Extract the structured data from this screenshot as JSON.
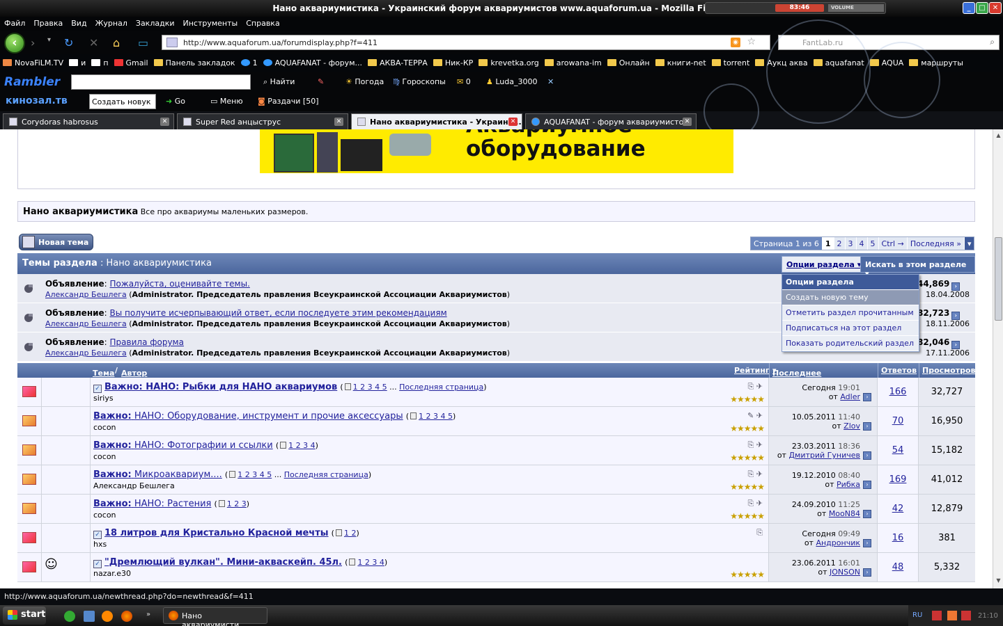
{
  "window": {
    "title": "Нано аквариумистика - Украинский форум аквариумистов www.aquaforum.ua - Mozilla Firefox",
    "player_lcd": "83:46",
    "volume": "VOLUME"
  },
  "menu": [
    "Файл",
    "Правка",
    "Вид",
    "Журнал",
    "Закладки",
    "Инструменты",
    "Справка"
  ],
  "nav": {
    "url": "http://www.aquaforum.ua/forumdisplay.php?f=411",
    "search_placeholder": "FantLab.ru"
  },
  "bookmarks": [
    "NovaFiLM.TV",
    "и",
    "п",
    "Gmail",
    "Панель закладок",
    "1",
    "AQUAFANAT - форум...",
    "АКВА-ТЕРРА",
    "Ник-КР",
    "krevetka.org",
    "arowana-im",
    "Онлайн",
    "книги-net",
    "torrent",
    "Аукц аква",
    "aquafanat",
    "AQUA",
    "маршруты"
  ],
  "rambler": {
    "logo": "Rambler",
    "find": "Найти",
    "weather": "Погода",
    "horoscopes": "Гороскопы",
    "count": "0",
    "user": "Luda_3000"
  },
  "kinozal": {
    "logo": "кинозал.тв",
    "input": "Создать новук",
    "go": "Go",
    "menu": "Меню",
    "distr": "Раздачи [50]"
  },
  "tabs": [
    {
      "label": "Corydoras habrosus"
    },
    {
      "label": "Super Red анцыструс"
    },
    {
      "label": "Нано аквариумистика - Украинс..."
    },
    {
      "label": "AQUAFANAT - форум аквариумистов"
    }
  ],
  "banner": {
    "text_top": "Аквариумное",
    "text": "оборудование"
  },
  "forum": {
    "title": "Нано аквариумистика",
    "desc": "Все про аквариумы маленьких размеров."
  },
  "new_thread": "Новая тема",
  "pagenav": {
    "label": "Страница 1 из 6",
    "pages": [
      "1",
      "2",
      "3",
      "4",
      "5"
    ],
    "next": "Ctrl →",
    "last": "Последняя »"
  },
  "section": {
    "title": "Темы раздела",
    "name": "Нано аквариумистика",
    "options": "Опции раздела",
    "search": "Искать в этом разделе"
  },
  "dropdown": [
    "Опции раздела",
    "Создать новую тему",
    "Отметить раздел прочитанным",
    "Подписаться на этот раздел",
    "Показать родительский раздел"
  ],
  "announcements": [
    {
      "prefix": "Объявление",
      "title": "Пожалуйста, оценивайте темы.",
      "author": "Александр Бешлега",
      "role": "Administrator. Председатель правления Всеукраинской Ассоциации Аквариумистов",
      "views": "44,869",
      "date": "18.04.2008"
    },
    {
      "prefix": "Объявление",
      "title": "Вы получите исчерпывающий ответ, если последуете этим рекомендациям",
      "author": "Александр Бешлега",
      "role": "Administrator. Председатель правления Всеукраинской Ассоциации Аквариумистов",
      "views": "82,723",
      "date": "18.11.2006"
    },
    {
      "prefix": "Объявление",
      "title": "Правила форума",
      "author": "Александр Бешлега",
      "role": "Administrator. Председатель правления Всеукраинской Ассоциации Аквариумистов",
      "views": "82,046",
      "date": "17.11.2006"
    }
  ],
  "columns": {
    "topic": "Тема",
    "author": "Автор",
    "rating": "Рейтинг",
    "last": "Последнее сообщение",
    "replies": "Ответов",
    "views": "Просмотров"
  },
  "threads": [
    {
      "prefix": "Важно: НАНО: Рыбки для НАНО аквариумов",
      "title": "",
      "bold": true,
      "pages": "1 2 3 4 5",
      "lastpage": "Последняя страница",
      "author": "siriys",
      "date": "Сегодня",
      "time": "19:01",
      "by": "Adler",
      "replies": "166",
      "views": "32,727"
    },
    {
      "prefix": "Важно:",
      "title": "НАНО: Оборудование, инструмент и прочие аксессуары",
      "bold": false,
      "pages": "1 2 3 4 5",
      "lastpage": "",
      "author": "cocon",
      "date": "10.05.2011",
      "time": "11:40",
      "by": "Zlov",
      "replies": "70",
      "views": "16,950"
    },
    {
      "prefix": "Важно:",
      "title": "НАНО: Фотографии и ссылки",
      "bold": false,
      "pages": "1 2 3 4",
      "lastpage": "",
      "author": "cocon",
      "date": "23.03.2011",
      "time": "18:36",
      "by": "Дмитрий Гуничев",
      "replies": "54",
      "views": "15,182"
    },
    {
      "prefix": "Важно:",
      "title": "Микроаквариум....",
      "bold": false,
      "pages": "1 2 3 4 5",
      "lastpage": "Последняя страница",
      "author": "Александр Бешлега",
      "date": "19.12.2010",
      "time": "08:40",
      "by": "Рибка",
      "replies": "169",
      "views": "41,012"
    },
    {
      "prefix": "Важно:",
      "title": "НАНО: Растения",
      "bold": false,
      "pages": "1 2 3",
      "lastpage": "",
      "author": "cocon",
      "date": "24.09.2010",
      "time": "11:25",
      "by": "MooN84",
      "replies": "42",
      "views": "12,879"
    },
    {
      "prefix": "",
      "title": "18 литров для Кристально Красной мечты",
      "bold": true,
      "pages": "1 2",
      "lastpage": "",
      "author": "hxs",
      "date": "Сегодня",
      "time": "09:49",
      "by": "Андрончик",
      "replies": "16",
      "views": "381"
    },
    {
      "prefix": "",
      "title": "\"Дремлющий вулкан\". Мини-акваскейп. 45л.",
      "bold": true,
      "pages": "1 2 3 4",
      "lastpage": "",
      "author": "nazar.e30",
      "date": "23.06.2011",
      "time": "16:01",
      "by": "JONSON",
      "replies": "48",
      "views": "5,332"
    }
  ],
  "status": "http://www.aquaforum.ua/newthread.php?do=newthread&f=411",
  "taskbar": {
    "start": "start",
    "task": "Нано аквариумисти...",
    "lang": "RU",
    "clock": "21:10"
  }
}
